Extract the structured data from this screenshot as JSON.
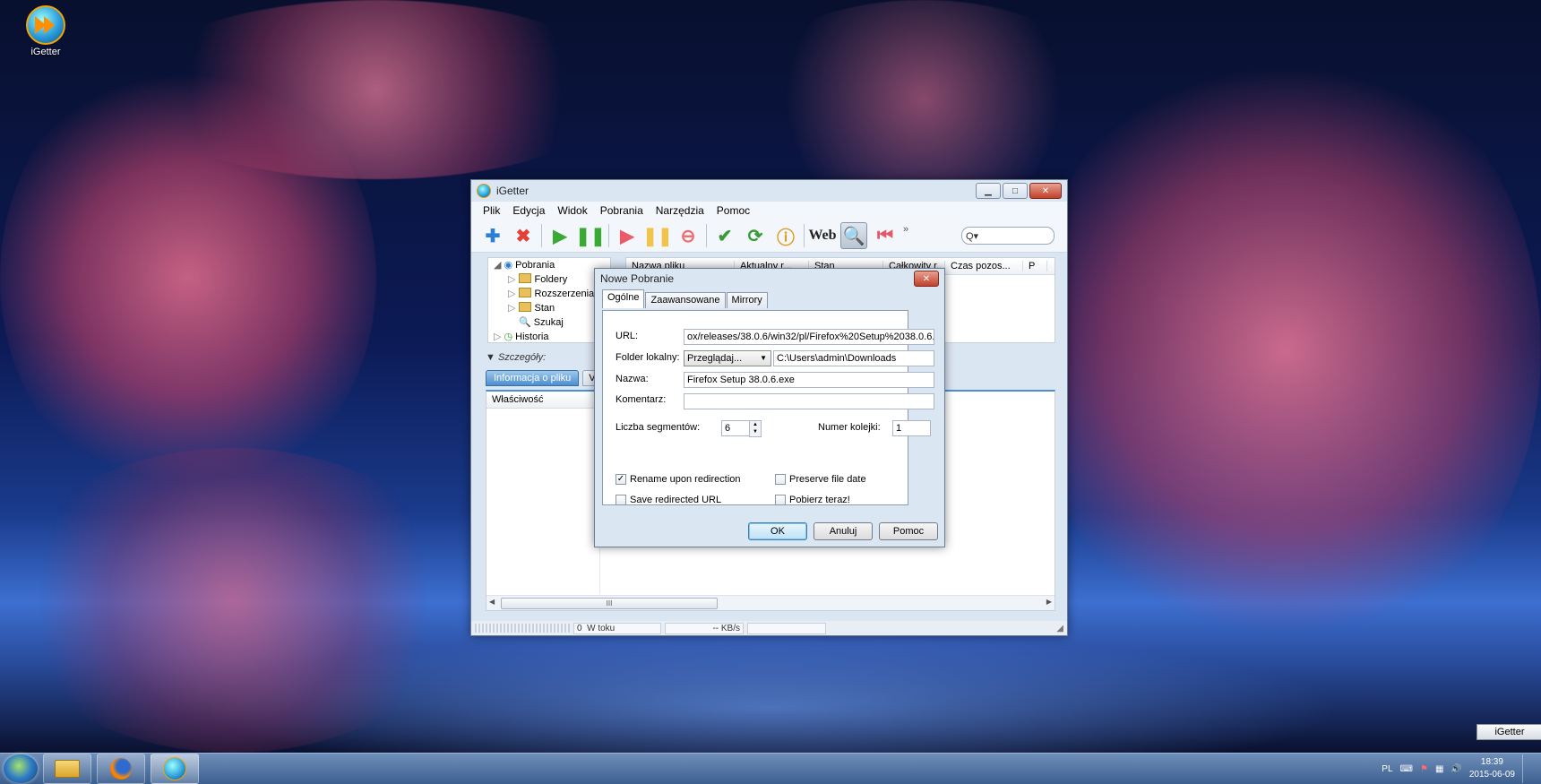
{
  "desktop": {
    "icon_label": "iGetter"
  },
  "main_window": {
    "title": "iGetter",
    "menu": [
      "Plik",
      "Edycja",
      "Widok",
      "Pobrania",
      "Narzędzia",
      "Pomoc"
    ],
    "toolbar": {
      "web_label": "Web",
      "overflow": "»",
      "search_placeholder": "Q▾"
    },
    "tree": {
      "root": "Pobrania",
      "children": [
        "Foldery",
        "Rozszerzenia",
        "Stan",
        "Szukaj"
      ],
      "history": "Historia"
    },
    "columns": [
      "Nazwa pliku",
      "Aktualny r...",
      "Stan",
      "Całkowity r...",
      "Czas pozos...",
      "P"
    ],
    "details_label": "Szczegóły:",
    "details_tab": "Informacja o pliku",
    "details_tab2": "V",
    "property_header": "Właściwość",
    "scroll_grip": "III",
    "status": {
      "count": "0",
      "state": "W toku",
      "speed": "-- KB/s"
    }
  },
  "dialog": {
    "title": "Nowe Pobranie",
    "close": "✕",
    "tabs": [
      "Ogólne",
      "Zaawansowane",
      "Mirrory"
    ],
    "url_label": "URL:",
    "url_value": "ox/releases/38.0.6/win32/pl/Firefox%20Setup%2038.0.6.exe",
    "folder_label": "Folder lokalny:",
    "browse_label": "Przeglądaj...",
    "folder_value": "C:\\Users\\admin\\Downloads",
    "name_label": "Nazwa:",
    "name_value": "Firefox Setup 38.0.6.exe",
    "comment_label": "Komentarz:",
    "comment_value": "",
    "segments_label": "Liczba segmentów:",
    "segments_value": "6",
    "queue_label": "Numer kolejki:",
    "queue_value": "1",
    "checkboxes": {
      "rename": {
        "label": "Rename upon redirection",
        "checked": true
      },
      "preserve": {
        "label": "Preserve file date",
        "checked": false
      },
      "save_redirected": {
        "label": "Save redirected URL",
        "checked": false
      },
      "download_now": {
        "label": "Pobierz teraz!",
        "checked": false
      }
    },
    "buttons": {
      "ok": "OK",
      "cancel": "Anuluj",
      "help": "Pomoc"
    }
  },
  "taskbar": {
    "mini_preview": "iGetter",
    "language": "PL",
    "time": "18:39",
    "date": "2015-06-09"
  },
  "colors": {
    "dialog_default_button": "#bfe1f7",
    "close_button": "#c1412a"
  }
}
